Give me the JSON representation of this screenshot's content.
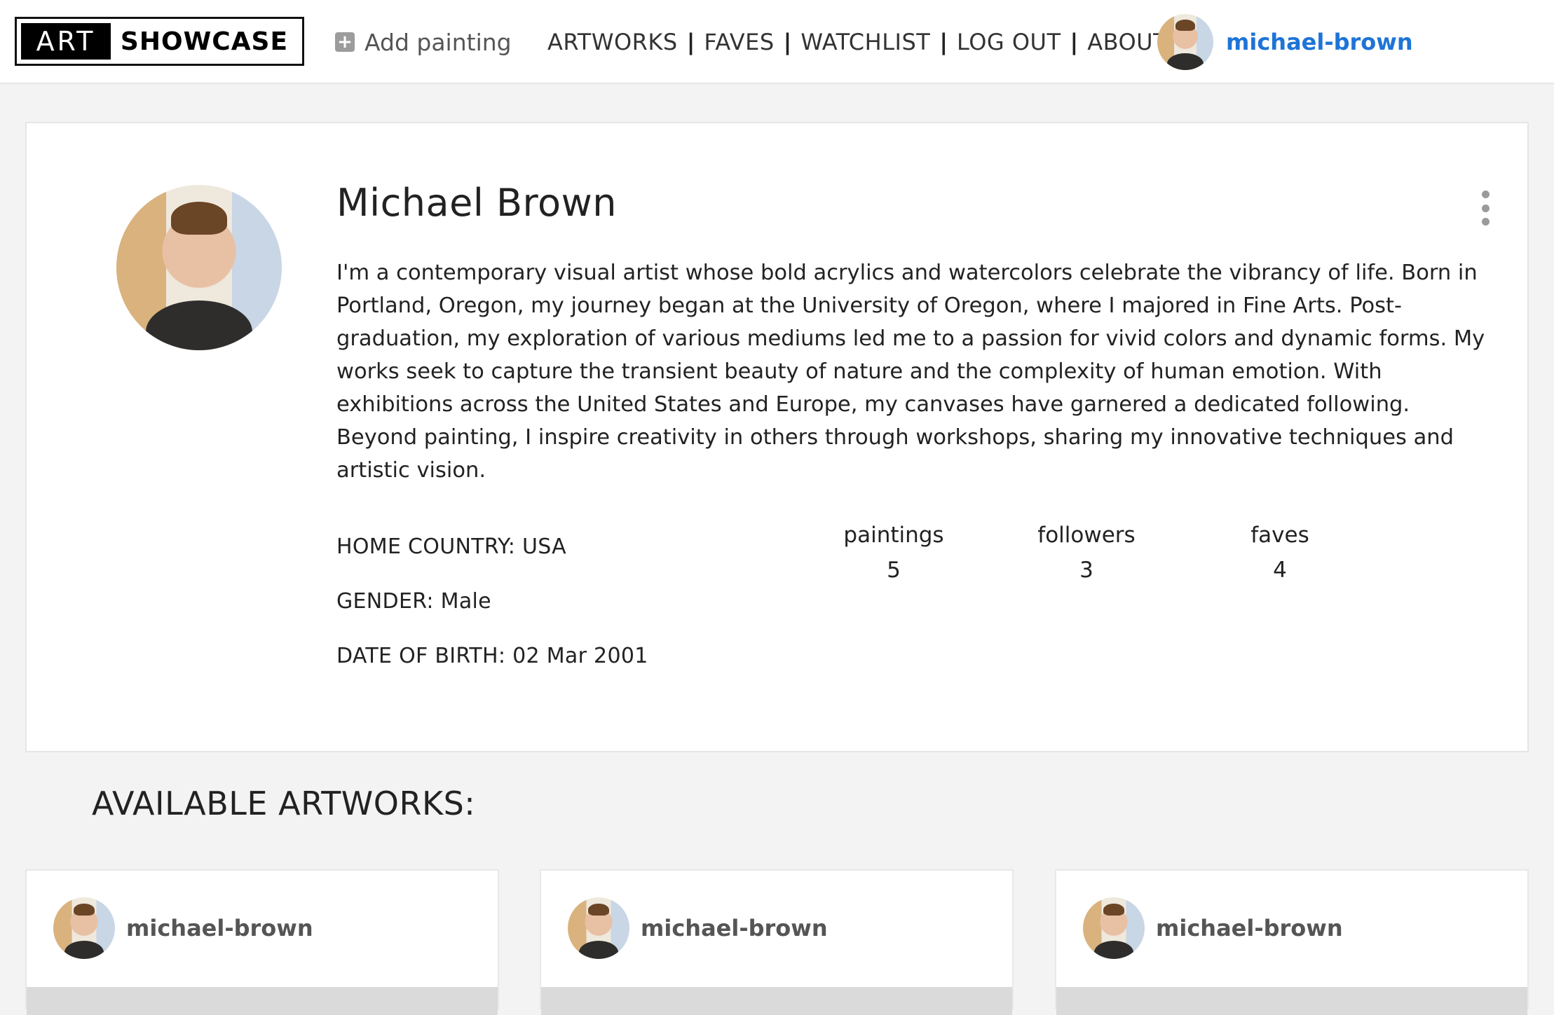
{
  "nav": {
    "logo_left": "ART",
    "logo_right": "SHOWCASE",
    "add_painting": "Add painting",
    "links": [
      "ARTWORKS",
      "FAVES",
      "WATCHLIST",
      "LOG OUT",
      "ABOUT"
    ],
    "separator": "|",
    "username": "michael-brown"
  },
  "profile": {
    "name": "Michael Brown",
    "bio": "I'm a contemporary visual artist whose bold acrylics and watercolors celebrate the vibrancy of life. Born in Portland, Oregon, my journey began at the University of Oregon, where I majored in Fine Arts. Post-graduation, my exploration of various mediums led me to a passion for vivid colors and dynamic forms. My works seek to capture the transient beauty of nature and the complexity of human emotion. With exhibitions across the United States and Europe, my canvases have garnered a dedicated following. Beyond painting, I inspire creativity in others through workshops, sharing my innovative techniques and artistic vision.",
    "home_country": "HOME COUNTRY: USA",
    "gender": "GENDER: Male",
    "dob": "DATE OF BIRTH: 02 Mar 2001",
    "stats": [
      {
        "label": "paintings",
        "value": "5"
      },
      {
        "label": "followers",
        "value": "3"
      },
      {
        "label": "faves",
        "value": "4"
      }
    ]
  },
  "artworks": {
    "title": "AVAILABLE ARTWORKS:",
    "cards": [
      {
        "username": "michael-brown"
      },
      {
        "username": "michael-brown"
      },
      {
        "username": "michael-brown"
      }
    ]
  },
  "colors": {
    "link_blue": "#1e74d6",
    "page_bg": "#f3f3f3"
  },
  "icons": {
    "add": "plus-square-icon",
    "menu": "kebab-menu-icon"
  }
}
